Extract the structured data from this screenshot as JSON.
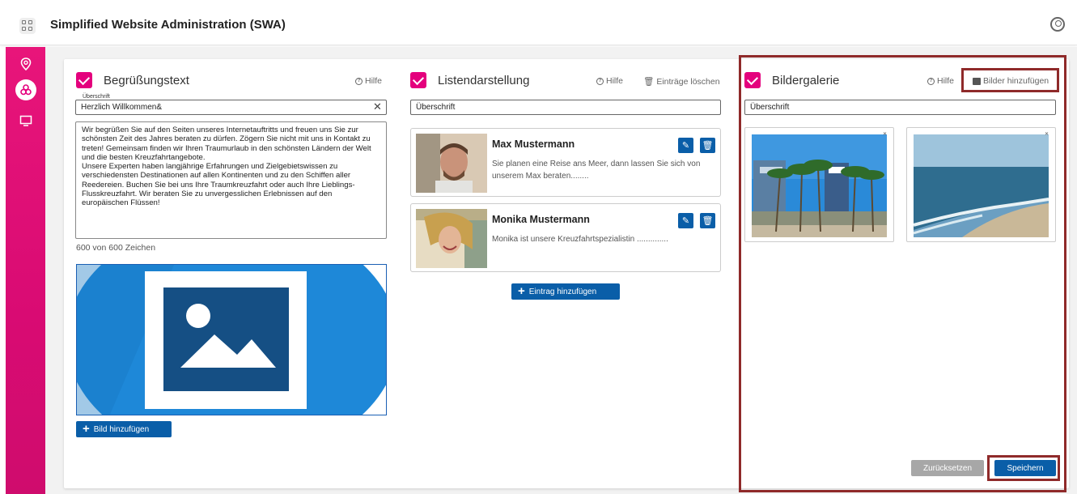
{
  "app": {
    "title": "Simplified Website Administration (SWA)"
  },
  "icons": {
    "apps": "apps-grid-icon",
    "user": "user-account-icon",
    "location": "location-pin-icon",
    "people": "people-icon",
    "monitor": "monitor-icon"
  },
  "colors": {
    "accent": "#e4007d",
    "primary": "#0a5ea8",
    "highlight": "#8f2a2a"
  },
  "greeting": {
    "title": "Begrüßungstext",
    "help": "Hilfe",
    "heading_label": "Überschrift",
    "heading_value": "Herzlich Willkommen&",
    "body": "Wir begrüßen Sie auf den Seiten unseres Internetauftritts und freuen uns Sie zur schönsten Zeit des Jahres beraten zu dürfen. Zögern Sie nicht mit uns in Kontakt zu treten! Gemeinsam finden wir Ihren Traumurlaub in den schönsten Ländern der Welt und die besten Kreuzfahrtangebote.\nUnsere Experten haben langjährige Erfahrungen und Zielgebietswissen zu verschiedensten Destinationen auf allen Kontinenten und zu den Schiffen aller Reedereien. Buchen Sie bei uns Ihre Traumkreuzfahrt oder auch Ihre Lieblings-Flusskreuzfahrt. Wir beraten Sie zu unvergesslichen Erlebnissen auf den europäischen Flüssen!",
    "counter": "600 von 600 Zeichen",
    "add_image": "Bild hinzufügen"
  },
  "list": {
    "title": "Listendarstellung",
    "help": "Hilfe",
    "delete_entries": "Einträge löschen",
    "heading_placeholder": "Überschrift",
    "entries": [
      {
        "name": "Max Mustermann",
        "text": "Sie planen eine Reise ans Meer, dann lassen Sie sich von unserem Max beraten........"
      },
      {
        "name": "Monika Mustermann",
        "text": "Monika ist unsere Kreuzfahrtspezialistin .............."
      }
    ],
    "add_entry": "Eintrag hinzufügen"
  },
  "gallery": {
    "title": "Bildergalerie",
    "help": "Hilfe",
    "add_images": "Bilder hinzufügen",
    "heading_placeholder": "Überschrift",
    "reset": "Zurücksetzen",
    "save": "Speichern"
  }
}
